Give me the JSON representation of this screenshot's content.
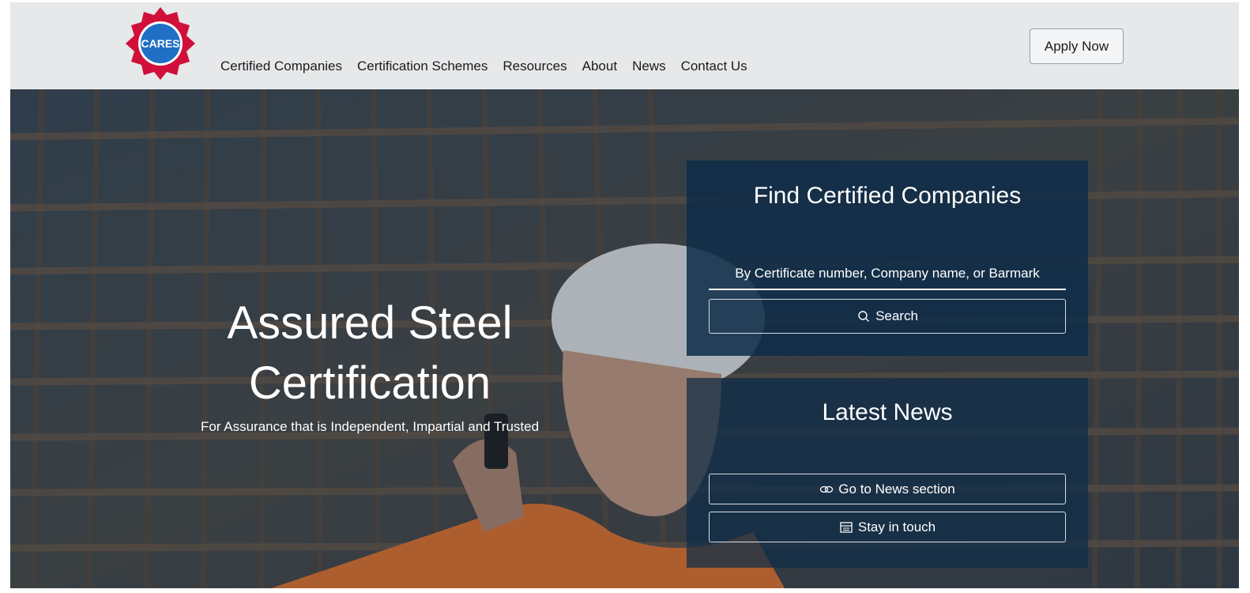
{
  "header": {
    "logo_text": "CARES",
    "nav": [
      "Certified Companies",
      "Certification Schemes",
      "Resources",
      "About",
      "News",
      "Contact Us"
    ],
    "apply_label": "Apply Now"
  },
  "hero": {
    "title_line1": "Assured Steel",
    "title_line2": "Certification",
    "subtitle": "For Assurance that is Independent, Impartial and Trusted"
  },
  "find_panel": {
    "heading": "Find Certified Companies",
    "search_placeholder": "By Certificate number, Company name, or Barmark",
    "search_button": "Search"
  },
  "news_panel": {
    "heading": "Latest News",
    "news_button": "Go to News section",
    "touch_button": "Stay in touch"
  },
  "icons": {
    "logo": "cares-gear-logo-icon",
    "search": "search-icon",
    "news": "link-icon",
    "touch": "newsletter-icon"
  },
  "colors": {
    "header_bg": "#e6e8ea",
    "panel_bg": "#0e2c48",
    "logo_red": "#d0103a",
    "logo_blue": "#1f6fc5"
  }
}
